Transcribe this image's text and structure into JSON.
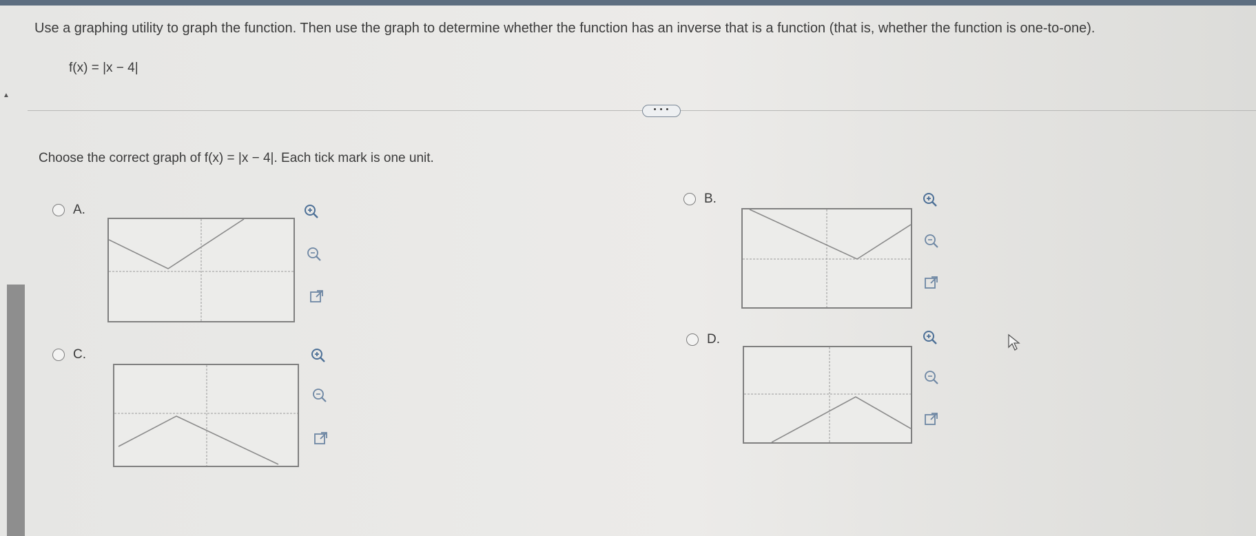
{
  "question": {
    "text": "Use a graphing utility to graph the function. Then use the graph to determine whether the function has an inverse that is a function (that is, whether the function is one-to-one).",
    "function": "f(x) = |x − 4|"
  },
  "more_button": "• • •",
  "prompt": "Choose the correct graph of f(x) = |x − 4|.  Each tick mark is one unit.",
  "options": [
    {
      "label": "A."
    },
    {
      "label": "B."
    },
    {
      "label": "C."
    },
    {
      "label": "D."
    }
  ],
  "icons": {
    "zoom_in": "magnifier-plus-icon",
    "zoom_out": "magnifier-minus-icon",
    "popout": "external-link-icon"
  }
}
